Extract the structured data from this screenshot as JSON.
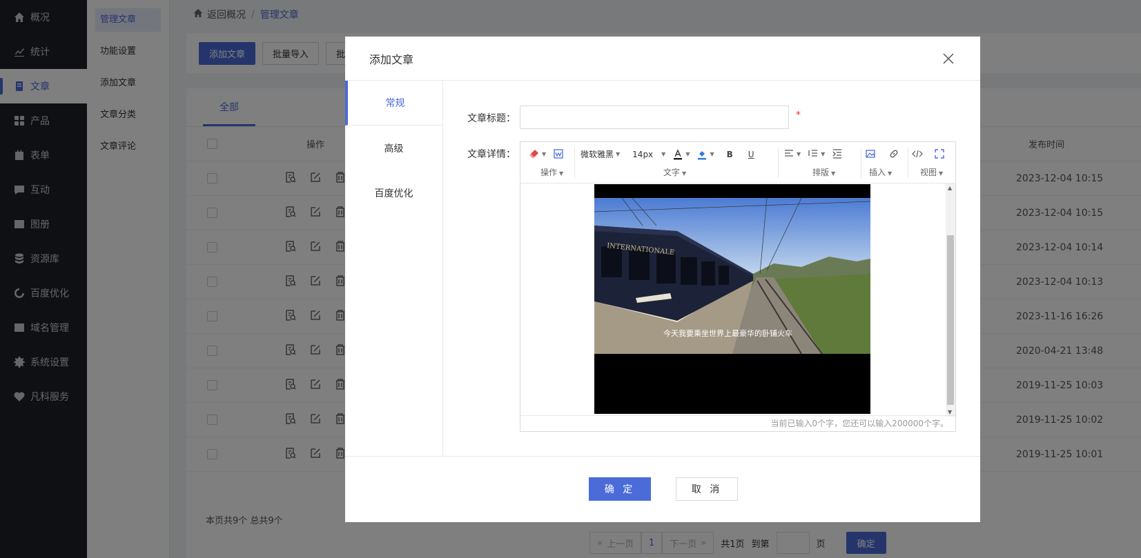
{
  "sidebar": {
    "items": [
      {
        "label": "概况",
        "icon": "home-icon"
      },
      {
        "label": "统计",
        "icon": "chart-icon"
      },
      {
        "label": "文章",
        "icon": "document-icon"
      },
      {
        "label": "产品",
        "icon": "grid-icon"
      },
      {
        "label": "表单",
        "icon": "form-icon"
      },
      {
        "label": "互动",
        "icon": "chat-icon"
      },
      {
        "label": "图册",
        "icon": "image-icon"
      },
      {
        "label": "资源库",
        "icon": "database-icon"
      },
      {
        "label": "百度优化",
        "icon": "seo-icon"
      },
      {
        "label": "域名管理",
        "icon": "web-icon"
      },
      {
        "label": "系统设置",
        "icon": "gear-icon"
      },
      {
        "label": "凡科服务",
        "icon": "heart-icon"
      }
    ],
    "active_index": 2
  },
  "submenu": {
    "items": [
      "管理文章",
      "功能设置",
      "添加文章",
      "文章分类",
      "文章评论"
    ]
  },
  "breadcrumb": {
    "back": "返回概况",
    "sep": "/",
    "current": "管理文章"
  },
  "toolbar": {
    "add": "添加文章",
    "import": "批量导入",
    "batch": "批"
  },
  "list": {
    "tab_all": "全部",
    "col_op": "操作",
    "col_time": "发布时间",
    "rows": [
      "2023-12-04 10:15",
      "2023-12-04 10:15",
      "2023-12-04 10:14",
      "2023-12-04 10:13",
      "2023-11-16 16:26",
      "2020-04-21 13:48",
      "2019-11-25 10:03",
      "2019-11-25 10:02",
      "2019-11-25 10:01"
    ],
    "footer": "本页共9个   总共9个"
  },
  "pager": {
    "prev": "上一页",
    "page": "1",
    "next": "下一页",
    "total": "共1页",
    "goto": "到第",
    "unit": "页",
    "confirm": "确定"
  },
  "modal": {
    "title": "添加文章",
    "tabs": [
      "常规",
      "高级",
      "百度优化"
    ],
    "title_label": "文章标题：",
    "title_value": "",
    "required": "*",
    "detail_label": "文章详情：",
    "editor": {
      "font": "微软雅黑",
      "size": "14px",
      "groups": [
        "操作",
        "文字",
        "排版",
        "插入",
        "视图"
      ],
      "status": "当前已输入0个字，您还可以输入200000个字。",
      "video_caption": "今天我要乘坐世界上最豪华的卧铺火车",
      "train_text": "INTERNATIONALE"
    },
    "ok": "确 定",
    "cancel": "取 消"
  },
  "colors": {
    "accent": "#4b6bd9",
    "sidebar_bg": "#1f2129"
  }
}
